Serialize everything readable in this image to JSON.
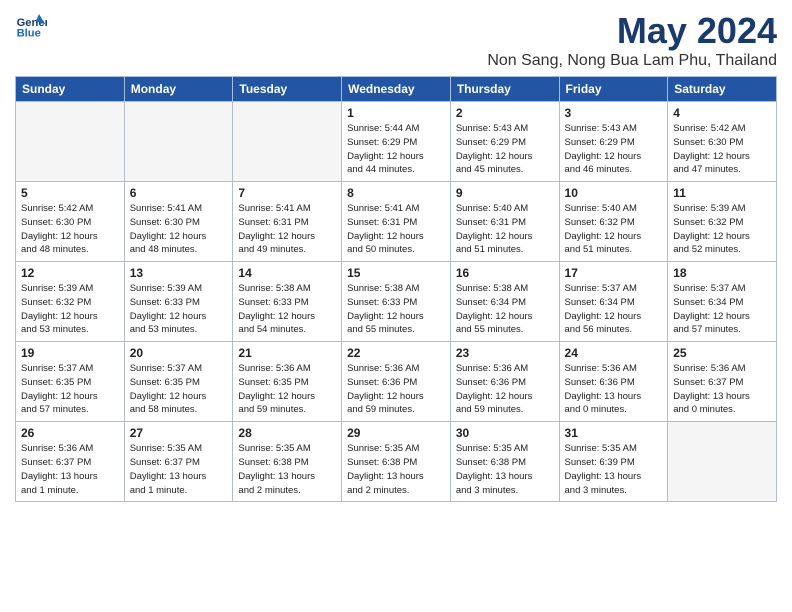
{
  "header": {
    "logo_line1": "General",
    "logo_line2": "Blue",
    "month": "May 2024",
    "location": "Non Sang, Nong Bua Lam Phu, Thailand"
  },
  "weekdays": [
    "Sunday",
    "Monday",
    "Tuesday",
    "Wednesday",
    "Thursday",
    "Friday",
    "Saturday"
  ],
  "weeks": [
    [
      {
        "day": "",
        "info": ""
      },
      {
        "day": "",
        "info": ""
      },
      {
        "day": "",
        "info": ""
      },
      {
        "day": "1",
        "info": "Sunrise: 5:44 AM\nSunset: 6:29 PM\nDaylight: 12 hours\nand 44 minutes."
      },
      {
        "day": "2",
        "info": "Sunrise: 5:43 AM\nSunset: 6:29 PM\nDaylight: 12 hours\nand 45 minutes."
      },
      {
        "day": "3",
        "info": "Sunrise: 5:43 AM\nSunset: 6:29 PM\nDaylight: 12 hours\nand 46 minutes."
      },
      {
        "day": "4",
        "info": "Sunrise: 5:42 AM\nSunset: 6:30 PM\nDaylight: 12 hours\nand 47 minutes."
      }
    ],
    [
      {
        "day": "5",
        "info": "Sunrise: 5:42 AM\nSunset: 6:30 PM\nDaylight: 12 hours\nand 48 minutes."
      },
      {
        "day": "6",
        "info": "Sunrise: 5:41 AM\nSunset: 6:30 PM\nDaylight: 12 hours\nand 48 minutes."
      },
      {
        "day": "7",
        "info": "Sunrise: 5:41 AM\nSunset: 6:31 PM\nDaylight: 12 hours\nand 49 minutes."
      },
      {
        "day": "8",
        "info": "Sunrise: 5:41 AM\nSunset: 6:31 PM\nDaylight: 12 hours\nand 50 minutes."
      },
      {
        "day": "9",
        "info": "Sunrise: 5:40 AM\nSunset: 6:31 PM\nDaylight: 12 hours\nand 51 minutes."
      },
      {
        "day": "10",
        "info": "Sunrise: 5:40 AM\nSunset: 6:32 PM\nDaylight: 12 hours\nand 51 minutes."
      },
      {
        "day": "11",
        "info": "Sunrise: 5:39 AM\nSunset: 6:32 PM\nDaylight: 12 hours\nand 52 minutes."
      }
    ],
    [
      {
        "day": "12",
        "info": "Sunrise: 5:39 AM\nSunset: 6:32 PM\nDaylight: 12 hours\nand 53 minutes."
      },
      {
        "day": "13",
        "info": "Sunrise: 5:39 AM\nSunset: 6:33 PM\nDaylight: 12 hours\nand 53 minutes."
      },
      {
        "day": "14",
        "info": "Sunrise: 5:38 AM\nSunset: 6:33 PM\nDaylight: 12 hours\nand 54 minutes."
      },
      {
        "day": "15",
        "info": "Sunrise: 5:38 AM\nSunset: 6:33 PM\nDaylight: 12 hours\nand 55 minutes."
      },
      {
        "day": "16",
        "info": "Sunrise: 5:38 AM\nSunset: 6:34 PM\nDaylight: 12 hours\nand 55 minutes."
      },
      {
        "day": "17",
        "info": "Sunrise: 5:37 AM\nSunset: 6:34 PM\nDaylight: 12 hours\nand 56 minutes."
      },
      {
        "day": "18",
        "info": "Sunrise: 5:37 AM\nSunset: 6:34 PM\nDaylight: 12 hours\nand 57 minutes."
      }
    ],
    [
      {
        "day": "19",
        "info": "Sunrise: 5:37 AM\nSunset: 6:35 PM\nDaylight: 12 hours\nand 57 minutes."
      },
      {
        "day": "20",
        "info": "Sunrise: 5:37 AM\nSunset: 6:35 PM\nDaylight: 12 hours\nand 58 minutes."
      },
      {
        "day": "21",
        "info": "Sunrise: 5:36 AM\nSunset: 6:35 PM\nDaylight: 12 hours\nand 59 minutes."
      },
      {
        "day": "22",
        "info": "Sunrise: 5:36 AM\nSunset: 6:36 PM\nDaylight: 12 hours\nand 59 minutes."
      },
      {
        "day": "23",
        "info": "Sunrise: 5:36 AM\nSunset: 6:36 PM\nDaylight: 12 hours\nand 59 minutes."
      },
      {
        "day": "24",
        "info": "Sunrise: 5:36 AM\nSunset: 6:36 PM\nDaylight: 13 hours\nand 0 minutes."
      },
      {
        "day": "25",
        "info": "Sunrise: 5:36 AM\nSunset: 6:37 PM\nDaylight: 13 hours\nand 0 minutes."
      }
    ],
    [
      {
        "day": "26",
        "info": "Sunrise: 5:36 AM\nSunset: 6:37 PM\nDaylight: 13 hours\nand 1 minute."
      },
      {
        "day": "27",
        "info": "Sunrise: 5:35 AM\nSunset: 6:37 PM\nDaylight: 13 hours\nand 1 minute."
      },
      {
        "day": "28",
        "info": "Sunrise: 5:35 AM\nSunset: 6:38 PM\nDaylight: 13 hours\nand 2 minutes."
      },
      {
        "day": "29",
        "info": "Sunrise: 5:35 AM\nSunset: 6:38 PM\nDaylight: 13 hours\nand 2 minutes."
      },
      {
        "day": "30",
        "info": "Sunrise: 5:35 AM\nSunset: 6:38 PM\nDaylight: 13 hours\nand 3 minutes."
      },
      {
        "day": "31",
        "info": "Sunrise: 5:35 AM\nSunset: 6:39 PM\nDaylight: 13 hours\nand 3 minutes."
      },
      {
        "day": "",
        "info": ""
      }
    ]
  ]
}
